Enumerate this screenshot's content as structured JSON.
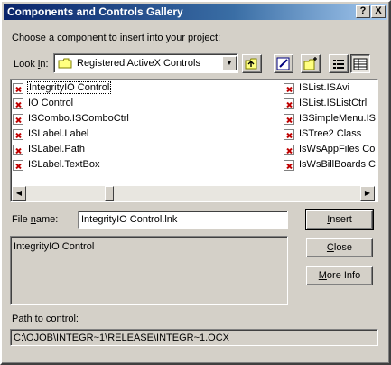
{
  "window": {
    "title": "Components and Controls Gallery",
    "help_btn": "?",
    "close_btn": "X"
  },
  "prompt": "Choose a component to insert into your project:",
  "look_in": {
    "label_pre": "Look ",
    "label_key": "i",
    "label_post": "n:",
    "value": "Registered ActiveX Controls"
  },
  "list": {
    "col1": [
      "IntegrityIO Control",
      "IO Control",
      "ISCombo.ISComboCtrl",
      "ISLabel.Label",
      "ISLabel.Path",
      "ISLabel.TextBox"
    ],
    "col2": [
      "ISList.ISAvi",
      "ISList.ISListCtrl",
      "ISSimpleMenu.ISM",
      "ISTree2 Class",
      "IsWsAppFiles Con",
      "IsWsBillBoards Co"
    ]
  },
  "file_name": {
    "label_pre": "File ",
    "label_key": "n",
    "label_post": "ame:",
    "value": "IntegrityIO Control.lnk"
  },
  "description": "IntegrityIO Control",
  "buttons": {
    "insert_key": "I",
    "insert_rest": "nsert",
    "close_key": "C",
    "close_rest": "lose",
    "more_pre": "",
    "more_key": "M",
    "more_rest": "ore Info"
  },
  "path": {
    "label": "Path to control:",
    "value": "C:\\OJOB\\INTEGR~1\\RELEASE\\INTEGR~1.OCX"
  }
}
